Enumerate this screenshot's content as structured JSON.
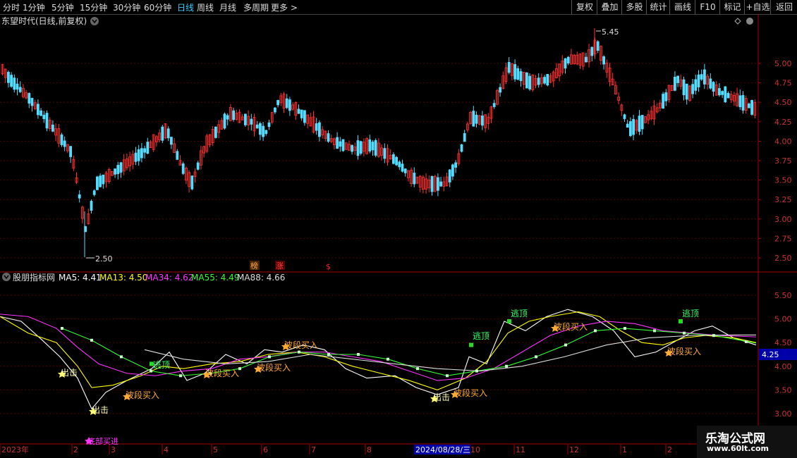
{
  "top_tabs": [
    "分时",
    "1分钟",
    "5分钟",
    "15分钟",
    "30分钟",
    "60分钟",
    "日线",
    "周线",
    "月线",
    "多周期",
    "更多 >"
  ],
  "active_tab": "日线",
  "right_buttons": [
    "复权",
    "叠加",
    "多股",
    "统计",
    "画线",
    "F10",
    "标记",
    "+自选",
    "返回"
  ],
  "main_panel": {
    "title": "东望时代(日线,前复权)",
    "high_label": "5.45",
    "low_label": "2.50",
    "markers": [
      "榜",
      "涨",
      "$"
    ],
    "y_ticks": [
      "5.00",
      "4.75",
      "4.50",
      "4.25",
      "4.00",
      "3.75",
      "3.50",
      "3.25",
      "3.00",
      "2.75",
      "2.50"
    ]
  },
  "indicator_panel": {
    "title": "股朋指标网",
    "legend": [
      {
        "label": "MA5: 4.41",
        "color": "#ffffff"
      },
      {
        "label": "MA13: 4.50",
        "color": "#ffff00"
      },
      {
        "label": "MA34: 4.62",
        "color": "#ff33ff"
      },
      {
        "label": "MA55: 4.49",
        "color": "#33ff33"
      },
      {
        "label": "MA88: 4.66",
        "color": "#dddddd"
      }
    ],
    "y_ticks": [
      "5.50",
      "5.00",
      "4.50",
      "4.00",
      "3.50",
      "3.00"
    ],
    "current_value": "4.25",
    "signals": {
      "escape_top": "逃顶",
      "band_buy": "波段买入",
      "strike": "出击",
      "bottom_buy": "底部买进"
    }
  },
  "time_axis": {
    "labels": [
      "2023年",
      "2",
      "3",
      "4",
      "5",
      "6",
      "7",
      "8",
      "10",
      "11",
      "12",
      "1",
      "2"
    ],
    "highlight_date": "2024/08/28/三"
  },
  "watermark": {
    "line1": "乐淘公式网",
    "line2": "www.60lt.com"
  }
}
